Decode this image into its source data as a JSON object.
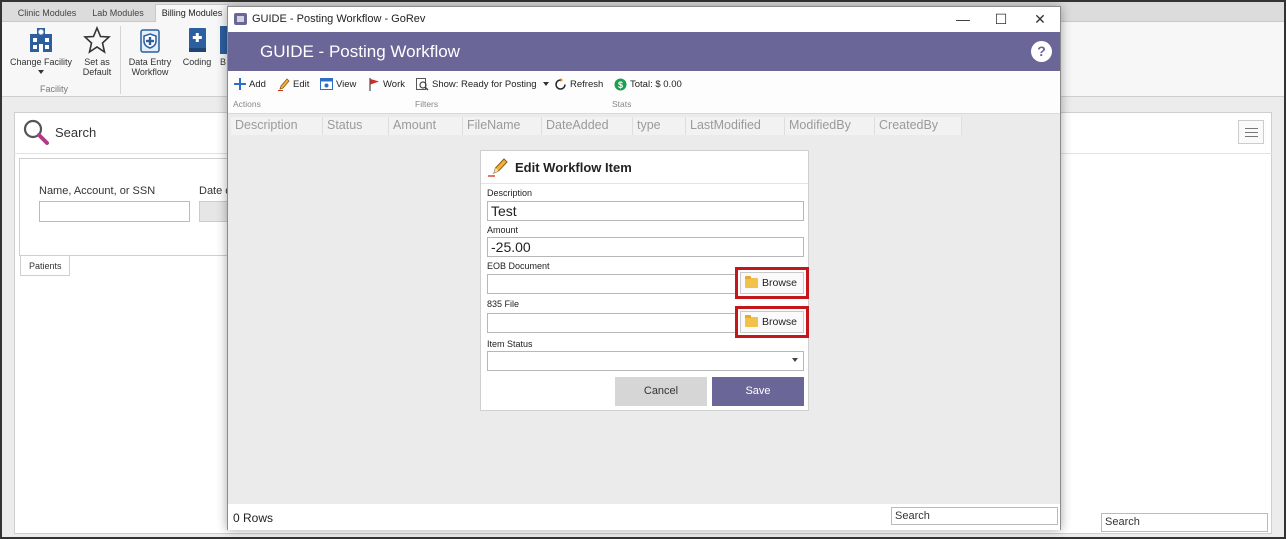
{
  "background": {
    "module_tabs": [
      "Clinic Modules",
      "Lab Modules",
      "Billing Modules"
    ],
    "ribbon": {
      "change_facility": "Change Facility",
      "set_as_default_line1": "Set as",
      "set_as_default_line2": "Default",
      "data_entry_line1": "Data Entry",
      "data_entry_line2": "Workflow",
      "coding": "Coding",
      "partial_label": "B",
      "group_facility": "Facility"
    },
    "search_title": "Search",
    "name_label": "Name, Account, or SSN",
    "date_label": "Date of Birth",
    "patients_tab": "Patients",
    "bottom_search": "Search"
  },
  "window": {
    "title": "GUIDE - Posting Workflow - GoRev",
    "header": "GUIDE - Posting Workflow",
    "help": "?",
    "controls": {
      "minimize": "—",
      "maximize": "☐",
      "close": "✕"
    },
    "toolbar": {
      "add": "Add",
      "edit": "Edit",
      "view": "View",
      "work": "Work",
      "show": "Show: Ready for Posting",
      "refresh": "Refresh",
      "total": "Total: $ 0.00",
      "group_actions": "Actions",
      "group_filters": "Filters",
      "group_stats": "Stats"
    },
    "columns": [
      "Description",
      "Status",
      "Amount",
      "FileName",
      "DateAdded",
      "type",
      "LastModified",
      "ModifiedBy",
      "CreatedBy"
    ],
    "footer": {
      "rows": "0 Rows",
      "search": "Search"
    }
  },
  "edit_card": {
    "title": "Edit Workflow Item",
    "description_label": "Description",
    "description_value": "Test",
    "amount_label": "Amount",
    "amount_value": "-25.00",
    "eob_label": "EOB Document",
    "eob_value": "",
    "file835_label": "835 File",
    "file835_value": "",
    "browse_label": "Browse",
    "status_label": "Item Status",
    "status_value": "",
    "cancel_label": "Cancel",
    "save_label": "Save"
  },
  "colors": {
    "accent": "#6a6698",
    "highlight": "#c3171b",
    "cancel_bg": "#d6d6d6"
  }
}
